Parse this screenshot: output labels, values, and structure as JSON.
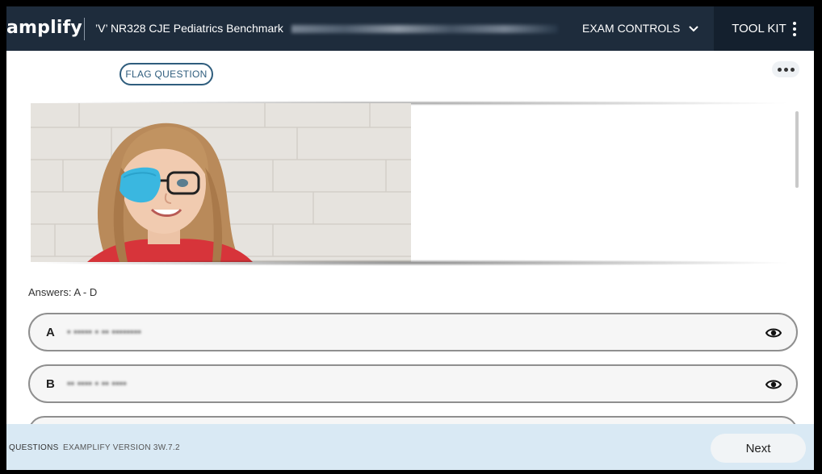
{
  "header": {
    "logo_text": "amplify",
    "exam_title": "NR328 CJE Pediatrics Benchmark",
    "exam_title_prefix": "’V’",
    "exam_controls_label": "EXAM CONTROLS",
    "toolkit_label": "TOOL KIT"
  },
  "question": {
    "flag_label": "FLAG QUESTION",
    "answers_label": "Answers: A - D"
  },
  "answers": [
    {
      "letter": "A",
      "text": "• ••••• • •• ••••••••"
    },
    {
      "letter": "B",
      "text": "•• •••• • •• ••••"
    }
  ],
  "footer": {
    "questions_label": "QUESTIONS",
    "version_label": "EXAMPLIFY VERSION 3W.7.2",
    "next_label": "Next"
  },
  "colors": {
    "header_bg": "#1e2c3c",
    "toolkit_bg": "#14202e",
    "accent": "#2f5d7d",
    "footer_bg": "#d9e9f4"
  }
}
